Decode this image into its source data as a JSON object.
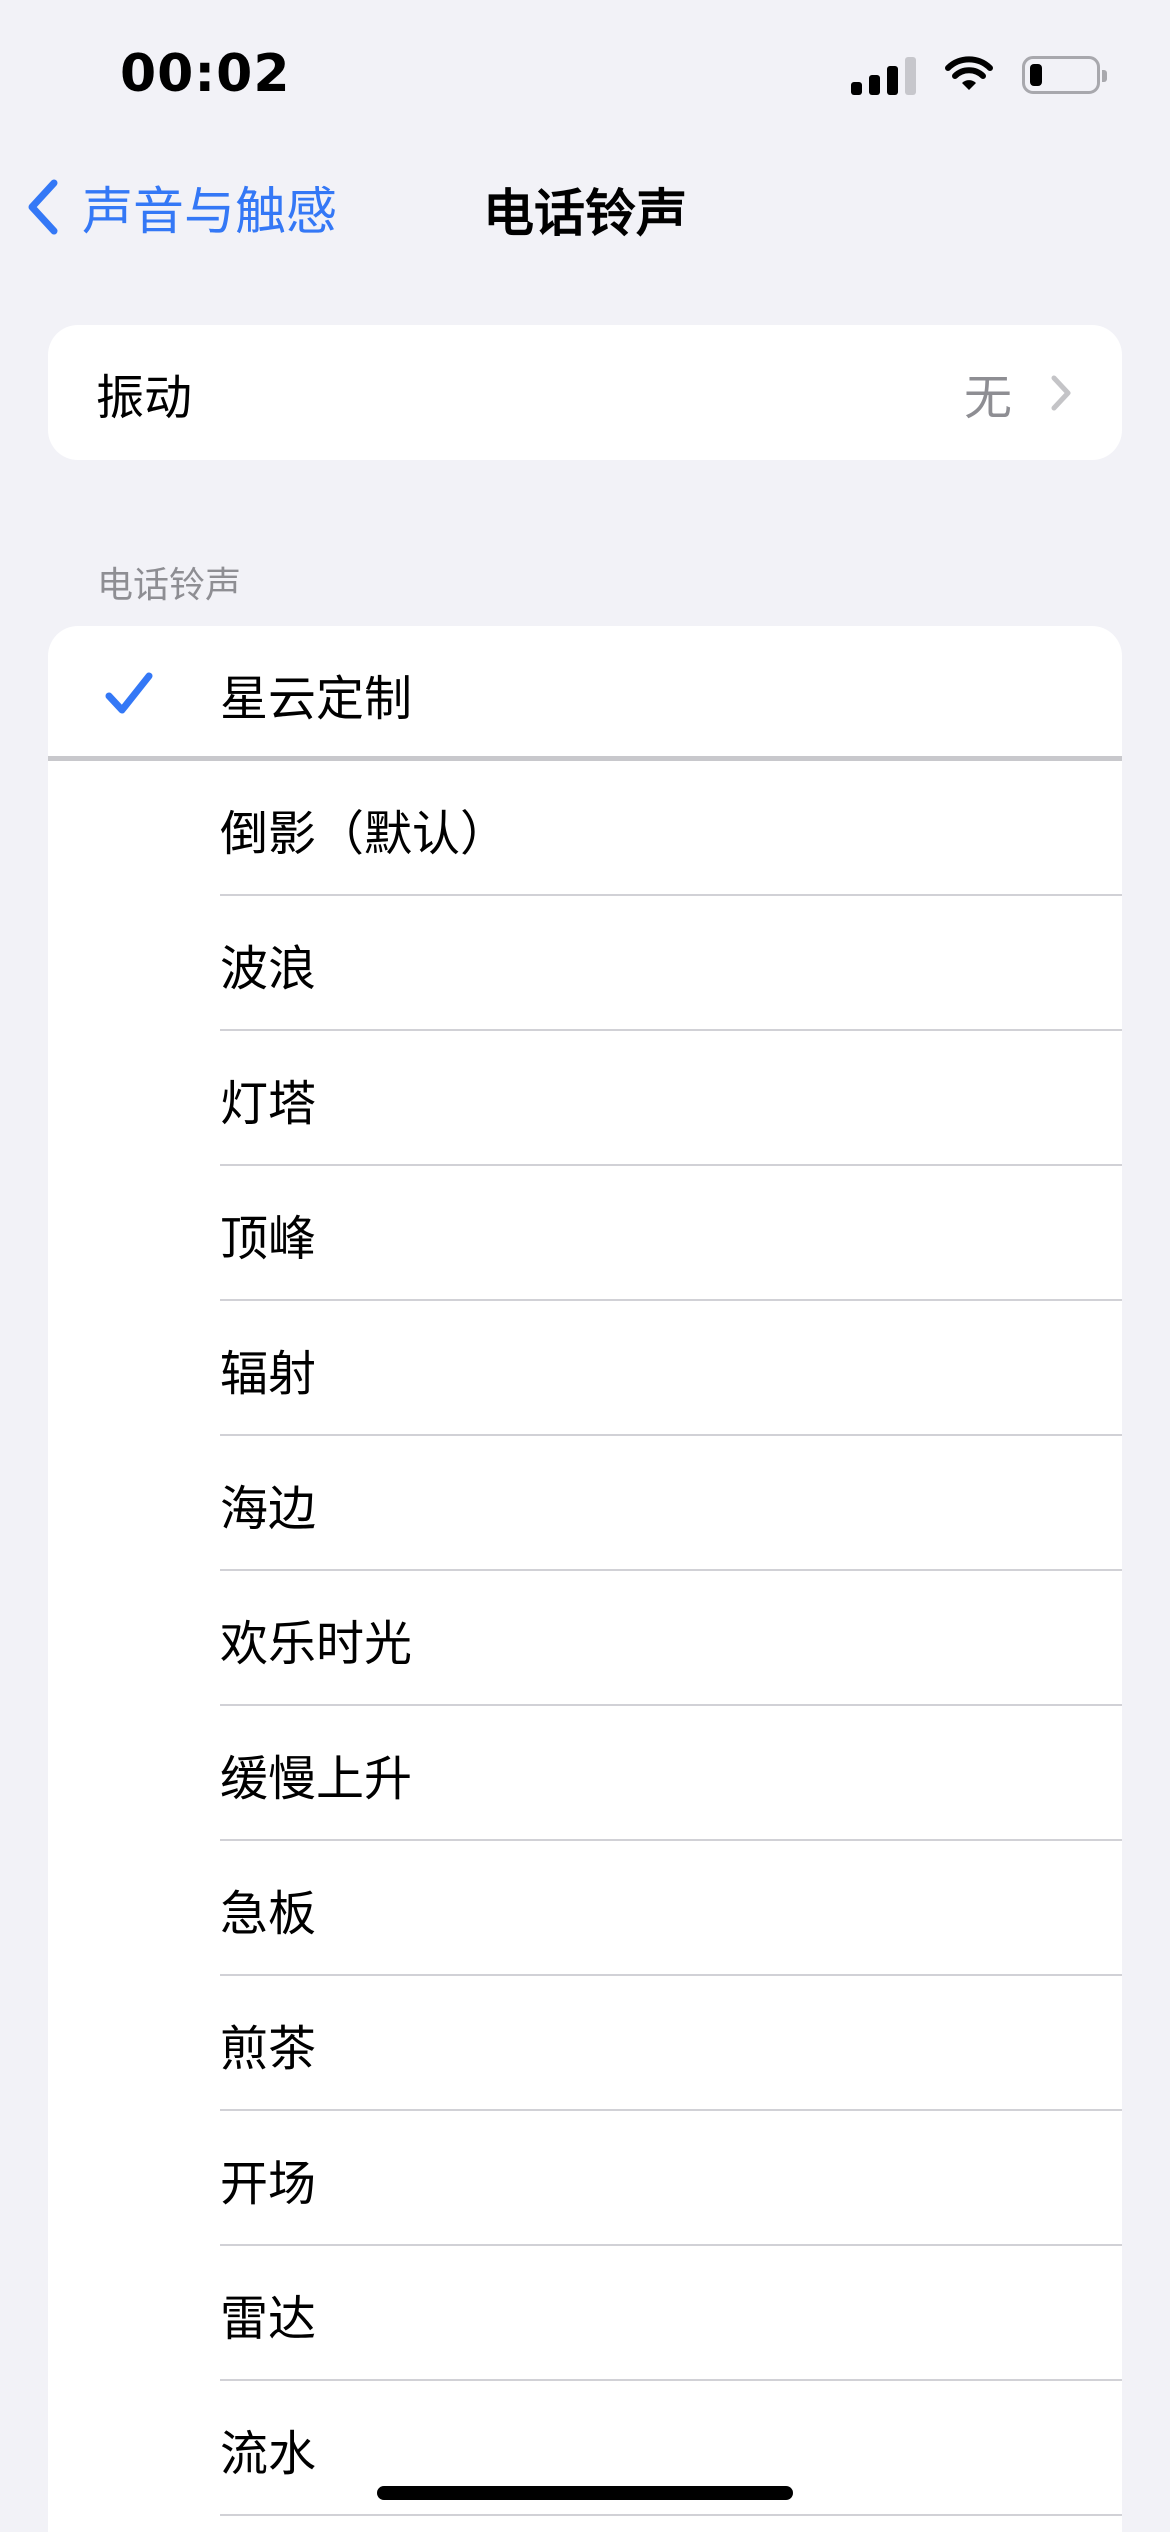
{
  "status_bar": {
    "time": "00:02"
  },
  "nav": {
    "back_label": "声音与触感",
    "title": "电话铃声"
  },
  "vibration": {
    "label": "振动",
    "value": "无"
  },
  "ringtones": {
    "section_header": "电话铃声",
    "items": [
      {
        "label": "星云定制",
        "selected": true
      },
      {
        "label": "倒影（默认）",
        "selected": false
      },
      {
        "label": "波浪",
        "selected": false
      },
      {
        "label": "灯塔",
        "selected": false
      },
      {
        "label": "顶峰",
        "selected": false
      },
      {
        "label": "辐射",
        "selected": false
      },
      {
        "label": "海边",
        "selected": false
      },
      {
        "label": "欢乐时光",
        "selected": false
      },
      {
        "label": "缓慢上升",
        "selected": false
      },
      {
        "label": "急板",
        "selected": false
      },
      {
        "label": "煎茶",
        "selected": false
      },
      {
        "label": "开场",
        "selected": false
      },
      {
        "label": "雷达",
        "selected": false
      },
      {
        "label": "流水",
        "selected": false
      }
    ]
  },
  "colors": {
    "accent": "#3478F6",
    "background": "#F2F2F7",
    "secondary_text": "#8E8E93"
  },
  "icons": {
    "back": "chevron-left-icon",
    "detail": "chevron-right-icon",
    "selected": "checkmark-icon"
  }
}
